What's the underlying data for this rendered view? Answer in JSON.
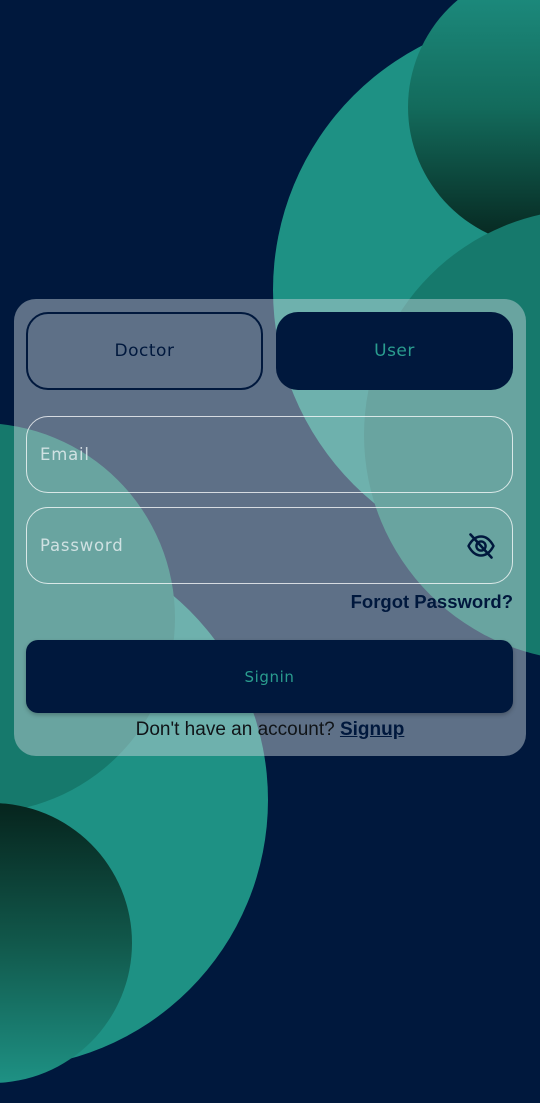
{
  "role_toggle": {
    "doctor_label": "Doctor",
    "user_label": "User",
    "selected": "User"
  },
  "form": {
    "email": {
      "value": "",
      "placeholder": "Email"
    },
    "password": {
      "value": "",
      "placeholder": "Password"
    },
    "password_toggle_icon": "eye-off-icon",
    "forgot_password_label": "Forgot Password?",
    "signin_label": "Signin"
  },
  "footer": {
    "prompt": "Don't have an account? ",
    "signup_link": "Signup"
  },
  "colors": {
    "background": "#00183d",
    "teal": "#1e9184",
    "teal_dark": "#0f3e33",
    "accent_text": "#2a9d8f"
  }
}
